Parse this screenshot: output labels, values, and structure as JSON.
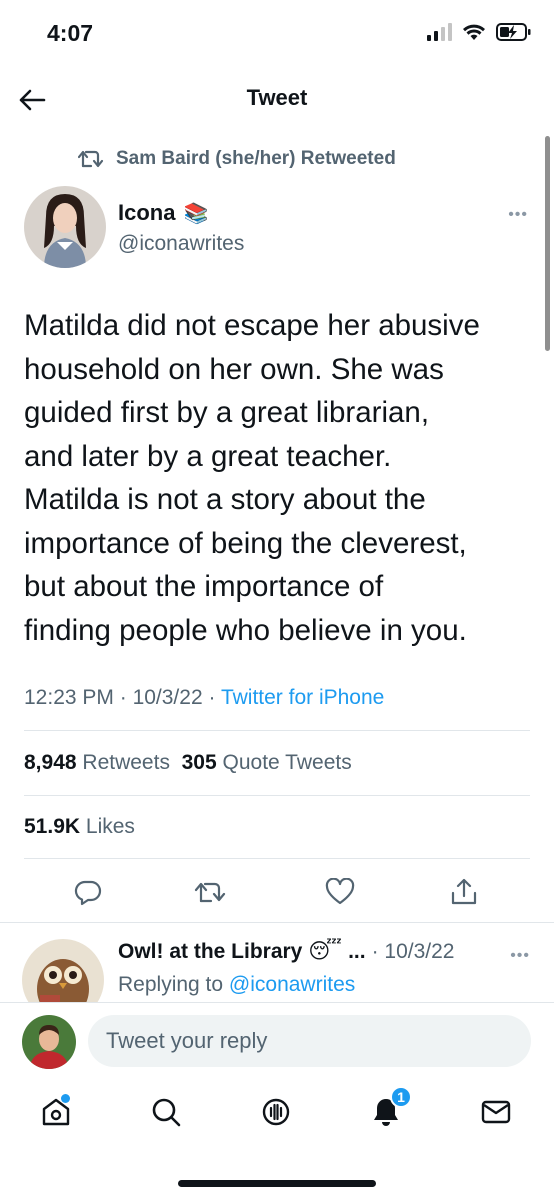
{
  "status_bar": {
    "time": "4:07"
  },
  "nav": {
    "title": "Tweet",
    "back_icon": "back-arrow-icon"
  },
  "retweet_context": {
    "text": "Sam Baird (she/her) Retweeted",
    "icon": "retweet-icon"
  },
  "author": {
    "name": "Icona",
    "emoji": "📚",
    "handle": "@iconawrites"
  },
  "tweet": {
    "text": "Matilda did not escape her abusive\nhousehold on her own. She was\nguided first by a great librarian,\nand later by a great teacher.\nMatilda is not a story about the\nimportance of being the cleverest,\nbut about the importance of\nfinding people who believe in you.",
    "time": "12:23 PM",
    "date": "10/3/22",
    "source": "Twitter for iPhone",
    "separator": " · "
  },
  "stats": {
    "retweets_count": "8,948",
    "retweets_label": "Retweets",
    "quotes_count": "305",
    "quotes_label": "Quote Tweets",
    "likes_count": "51.9K",
    "likes_label": "Likes"
  },
  "actions": [
    "reply-icon",
    "retweet-icon",
    "like-icon",
    "share-icon"
  ],
  "reply": {
    "name": "Owl! at the Library",
    "emoji": "😴",
    "ellipsis": "...",
    "date": "· 10/3/22",
    "replying_prefix": "Replying to",
    "replying_to": "@iconawrites"
  },
  "compose": {
    "placeholder": "Tweet your reply"
  },
  "tabbar": {
    "notifications_count": "1"
  },
  "colors": {
    "accent": "#1d9bf0",
    "text": "#0f1419",
    "muted": "#536471"
  }
}
